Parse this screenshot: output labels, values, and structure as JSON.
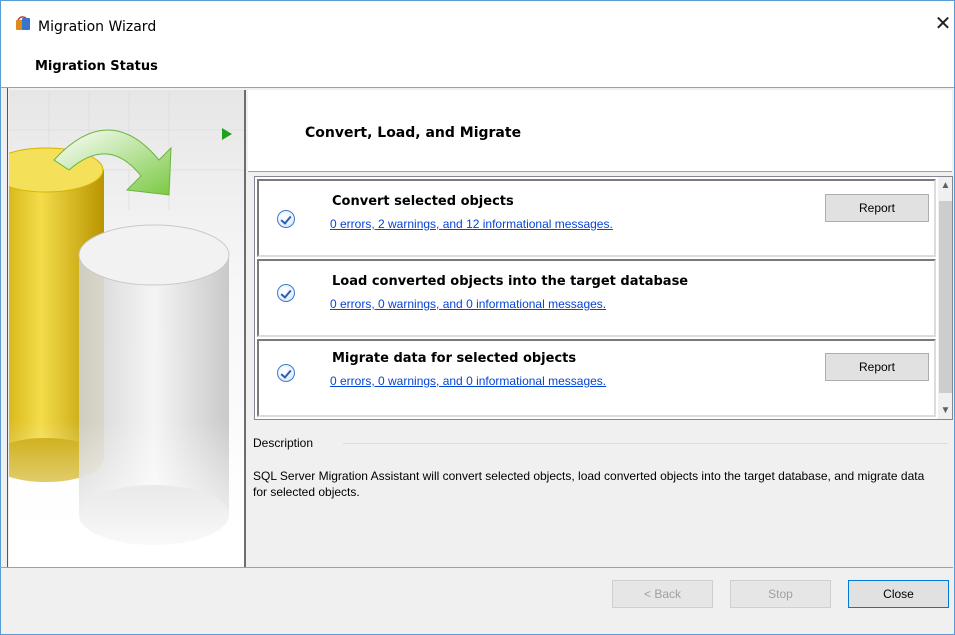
{
  "window": {
    "title": "Migration Wizard",
    "close_icon": "close-icon",
    "app_icon": "migration-wizard-icon"
  },
  "header": {
    "title": "Migration Status"
  },
  "step": {
    "title": "Convert, Load, and Migrate",
    "indicator_icon": "play-arrow-icon"
  },
  "tasks": [
    {
      "title": "Convert selected objects",
      "link": "0 errors, 2 warnings, and 12 informational messages.",
      "has_report": true,
      "report_label": "Report"
    },
    {
      "title": "Load converted objects into the target database",
      "link": "0 errors, 0 warnings, and 0 informational messages.",
      "has_report": false
    },
    {
      "title": "Migrate data for selected objects",
      "link": "0 errors, 0 warnings, and 0 informational messages.",
      "has_report": true,
      "report_label": "Report"
    }
  ],
  "description": {
    "label": "Description",
    "text": "SQL Server Migration Assistant will convert selected objects, load converted objects into the target database, and migrate data for selected objects."
  },
  "buttons": {
    "back": "< Back",
    "stop": "Stop",
    "close": "Close"
  },
  "colors": {
    "link": "#0645d8",
    "accent": "#0078d7",
    "arrow": "#1fa31f"
  }
}
